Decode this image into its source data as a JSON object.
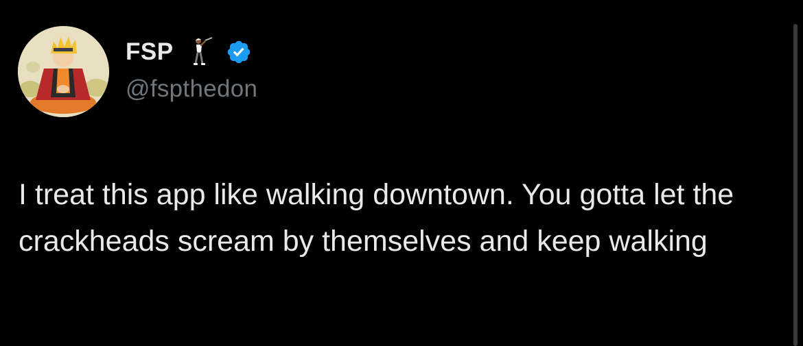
{
  "tweet": {
    "display_name": "FSP",
    "handle": "@fspthedon",
    "name_emoji_icon": "golfer-emoji-icon",
    "verified_icon": "verified-badge-icon",
    "text": "I treat this app like walking downtown. You gotta let the crackheads scream by themselves and keep walking"
  },
  "colors": {
    "background": "#000000",
    "primary_text": "#e7e9ea",
    "secondary_text": "#71767b",
    "verified_blue": "#1d9bf0"
  }
}
